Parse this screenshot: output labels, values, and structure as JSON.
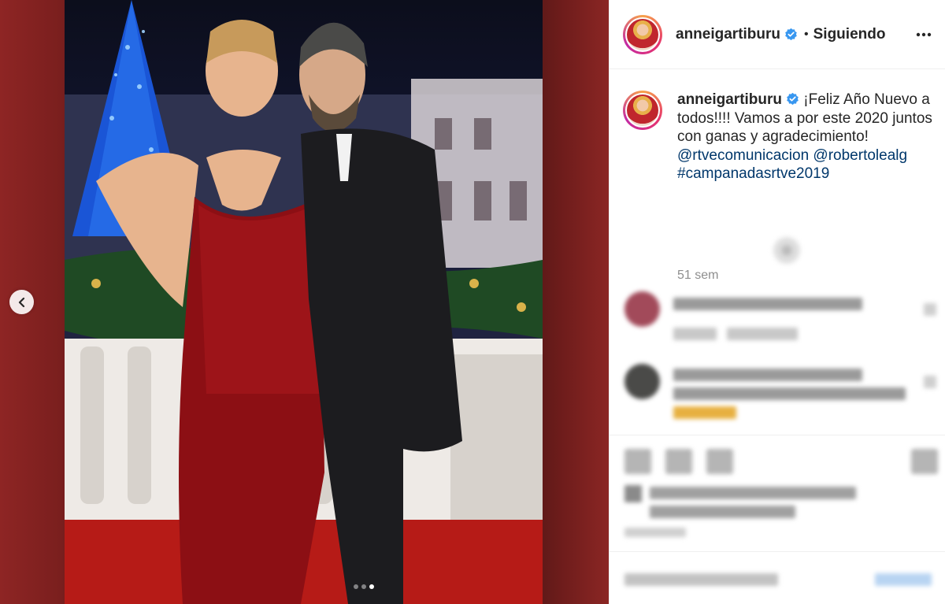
{
  "post": {
    "author": "anneigartiburu",
    "follow_state": "Siguiendo",
    "separator": "•",
    "caption": {
      "text": "¡Feliz Año Nuevo a todos!!!! Vamos a por este 2020 juntos con ganas y agradecimiento!",
      "mentions": [
        "@rtvecomunicacion",
        "@robertolealg"
      ],
      "hashtag": "#campanadasrtve2019"
    },
    "timestamp": "51 sem",
    "carousel": {
      "total": 3,
      "active": 3
    }
  },
  "icons": {
    "verified": "verified-badge-icon",
    "more": "more-options-icon",
    "prev": "chevron-left-icon"
  },
  "colors": {
    "verified": "#3897f0",
    "link": "#00376b",
    "muted": "#8e8e8e",
    "text": "#262626"
  }
}
